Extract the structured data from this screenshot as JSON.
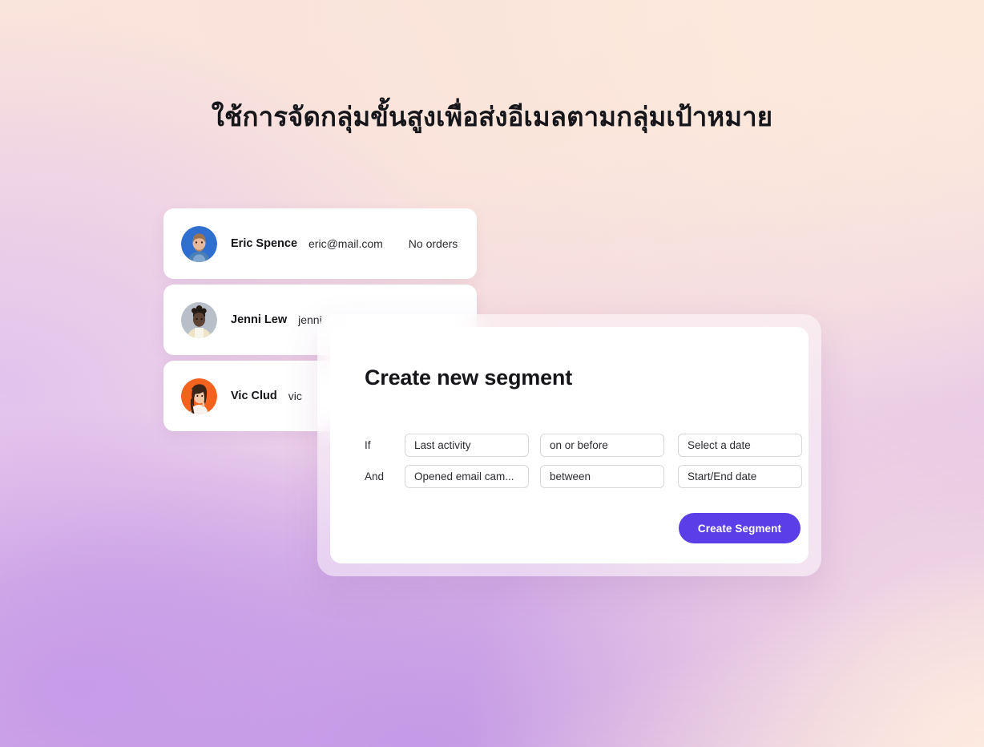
{
  "headline": "ใช้การจัดกลุ่มขั้นสูงเพื่อส่งอีเมลตามกลุ่มเป้าหมาย",
  "colors": {
    "accent": "#5B3EE8",
    "text": "#16161A",
    "field_border": "#D8D8DC",
    "bg_peach": "#FBE6DD",
    "bg_lavender": "#C79BE8",
    "avatar_eric": "#2F6FD0",
    "avatar_jenni": "#B9BFC9",
    "avatar_vic": "#F4631E"
  },
  "contacts": [
    {
      "name": "Eric Spence",
      "email": "eric@mail.com",
      "orders": "No orders",
      "avatar": "avatar-eric-spence"
    },
    {
      "name": "Jenni Lew",
      "email": "jenni",
      "orders": "",
      "avatar": "avatar-jenni-lew"
    },
    {
      "name": "Vic Clud",
      "email": "vic",
      "orders": "",
      "avatar": "avatar-vic-clud"
    }
  ],
  "modal": {
    "title": "Create new segment",
    "rules": [
      {
        "label": "If",
        "attribute": "Last activity",
        "operator": "on or before",
        "value": "Select a date"
      },
      {
        "label": "And",
        "attribute": "Opened email cam...",
        "operator": "between",
        "value": "Start/End date"
      }
    ],
    "submit_label": "Create Segment"
  }
}
